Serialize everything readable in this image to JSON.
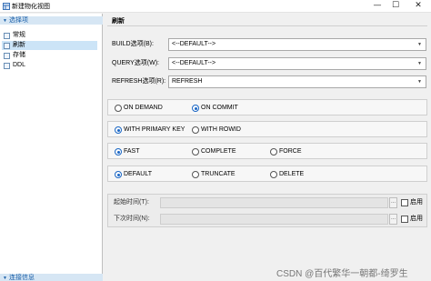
{
  "window": {
    "title": "新建物化视图",
    "minimize": "—",
    "maximize": "☐",
    "close": "✕"
  },
  "sidebar": {
    "group_top": "选择项",
    "items": [
      {
        "label": "常规"
      },
      {
        "label": "刷新",
        "selected": true
      },
      {
        "label": "存储"
      },
      {
        "label": "DDL"
      }
    ],
    "group_bottom": "连接信息"
  },
  "section": {
    "title": "刷新"
  },
  "fields": {
    "build": {
      "label": "BUILD选项(B):",
      "value": "<--DEFAULT-->"
    },
    "query": {
      "label": "QUERY选项(W):",
      "value": "<--DEFAULT-->"
    },
    "refresh": {
      "label": "REFRESH选项(R):",
      "value": "REFRESH"
    }
  },
  "radio_groups": [
    {
      "options": [
        {
          "label": "ON DEMAND",
          "checked": false
        },
        {
          "label": "ON COMMIT",
          "checked": true
        }
      ]
    },
    {
      "options": [
        {
          "label": "WITH PRIMARY KEY",
          "checked": true
        },
        {
          "label": "WITH ROWID",
          "checked": false
        }
      ]
    },
    {
      "options": [
        {
          "label": "FAST",
          "checked": true
        },
        {
          "label": "COMPLETE",
          "checked": false
        },
        {
          "label": "FORCE",
          "checked": false
        }
      ]
    },
    {
      "options": [
        {
          "label": "DEFAULT",
          "checked": true
        },
        {
          "label": "TRUNCATE",
          "checked": false
        },
        {
          "label": "DELETE",
          "checked": false
        }
      ]
    }
  ],
  "times": {
    "start": {
      "label": "起始时间(T):",
      "value": "",
      "more": "...",
      "enable_label": "启用"
    },
    "next": {
      "label": "下次时间(N):",
      "value": "",
      "more": "...",
      "enable_label": "启用"
    }
  },
  "watermark": "CSDN @百代繁华一朝都-绮罗生",
  "colors": {
    "accent": "#1a66c4",
    "selection": "#cce4f7",
    "group_header": "#d6e6f4"
  }
}
